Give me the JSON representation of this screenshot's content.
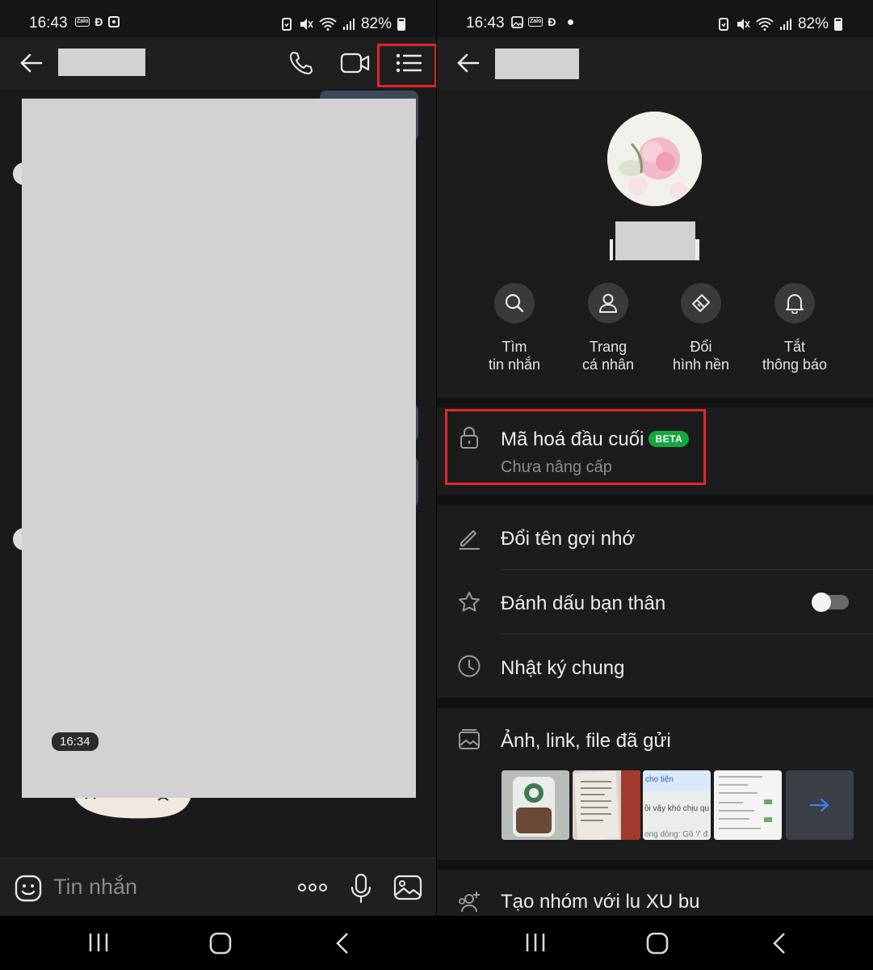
{
  "left": {
    "status": {
      "time": "16:43",
      "battery": "82%",
      "notif_icons": [
        "zalo-icon",
        "d-icon",
        "square-icon"
      ]
    },
    "header": {
      "back_icon": "arrow-left-icon",
      "call_icon": "phone-icon",
      "video_icon": "video-camera-icon",
      "menu_icon": "list-menu-icon"
    },
    "chat": {
      "timestamp": "16:34"
    },
    "composer": {
      "placeholder": "Tin nhắn",
      "emoji_icon": "emoji-icon",
      "more_icon": "more-dots-icon",
      "mic_icon": "microphone-icon",
      "image_icon": "image-icon"
    }
  },
  "right": {
    "status": {
      "time": "16:43",
      "battery": "82%"
    },
    "actions": [
      {
        "line1": "Tìm",
        "line2": "tin nhắn",
        "icon": "search-icon"
      },
      {
        "line1": "Trang",
        "line2": "cá nhân",
        "icon": "person-icon"
      },
      {
        "line1": "Đổi",
        "line2": "hình nền",
        "icon": "paint-brush-icon"
      },
      {
        "line1": "Tắt",
        "line2": "thông báo",
        "icon": "bell-icon"
      }
    ],
    "encryption": {
      "title": "Mã hoá đầu cuối",
      "badge": "BETA",
      "subtitle": "Chưa nâng cấp"
    },
    "options": {
      "rename": "Đổi tên gợi nhớ",
      "best_friend": "Đánh dấu bạn thân",
      "best_friend_on": false,
      "diary": "Nhật ký chung"
    },
    "media": {
      "title": "Ảnh, link, file đã gửi",
      "thumb3_line1": "cho tiện",
      "thumb3_line2": "ồi vậy khó chịu qu",
      "thumb3_line3": "ong dòng: Gõ '/' đ"
    },
    "create_group": "Tạo nhóm với lu XU bu"
  },
  "colors": {
    "highlight": "#e0262c",
    "beta": "#14a83f",
    "accent": "#2f7ff0"
  }
}
